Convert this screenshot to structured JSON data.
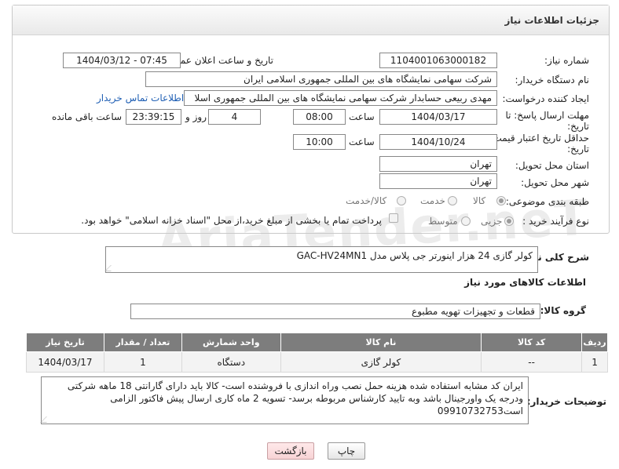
{
  "panel": {
    "title": "جزئیات اطلاعات نیاز"
  },
  "fields": {
    "need_number_label": "شماره نیاز:",
    "need_number": "1104001063000182",
    "announce_label": "تاریخ و ساعت اعلان عمومی:",
    "announce_value": "1404/03/12 - 07:45",
    "buyer_org_label": "نام دستگاه خریدار:",
    "buyer_org": "شرکت سهامی نمایشگاه های بین المللی جمهوری اسلامی ایران",
    "creator_label": "ایجاد کننده درخواست:",
    "creator": "مهدی  ربیعی حسابدار شرکت سهامی نمایشگاه های بین المللی جمهوری اسلا",
    "buyer_contact_link": "اطلاعات تماس خریدار",
    "deadline_label": "مهلت ارسال پاسخ: تا تاریخ:",
    "deadline_date": "1404/03/17",
    "time_label": "ساعت",
    "deadline_time": "08:00",
    "days_value": "4",
    "days_label": "روز و",
    "remaining_time": "23:39:15",
    "remaining_label": "ساعت باقی مانده",
    "price_deadline_label": "حداقل تاریخ اعتبار قیمت: تا تاریخ:",
    "price_deadline_date": "1404/10/24",
    "price_time_label": "ساعت",
    "price_deadline_time": "10:00",
    "province_label": "استان محل تحویل:",
    "province": "تهران",
    "city_label": "شهر محل تحویل:",
    "city": "تهران",
    "category_label": "طبقه بندی موضوعی:",
    "category_options": [
      "کالا",
      "خدمت",
      "کالا/خدمت"
    ],
    "process_label": "نوع فرآیند خرید :",
    "process_options": [
      "جزیی",
      "متوسط"
    ],
    "payment_note": "پرداخت تمام یا بخشی از مبلغ خرید،از محل \"اسناد خزانه اسلامی\" خواهد بود."
  },
  "description": {
    "label": "شرح کلی نیاز:",
    "value": "کولر گازی 24 هزار اینورتر جی پلاس مدل  GAC-HV24MN1"
  },
  "goods_info": {
    "heading": "اطلاعات کالاهای مورد نیاز",
    "group_label": "گروه کالا:",
    "group_value": "قطعات و تجهیزات تهویه مطبوع"
  },
  "table": {
    "headers": [
      "ردیف",
      "کد کالا",
      "نام کالا",
      "واحد شمارش",
      "تعداد / مقدار",
      "تاریخ نیاز"
    ],
    "rows": [
      [
        "1",
        "--",
        "کولر گازی",
        "دستگاه",
        "1",
        "1404/03/17"
      ]
    ]
  },
  "buyer_notes": {
    "label": "توضیحات خریدار:",
    "value": "ایران کد مشابه استفاده شده هزینه حمل نصب وراه اندازی با فروشنده است- کالا باید دارای گارانتی 18 ماهه شرکتی ودرجه یک واورجینال باشد وبه تایید کارشناس مربوطه برسد- تسویه 2 ماه کاری ارسال پیش فاکتور الزامی است09910732753"
  },
  "buttons": {
    "print": "چاپ",
    "back": "بازگشت"
  },
  "watermark": "AriaTender.neT"
}
